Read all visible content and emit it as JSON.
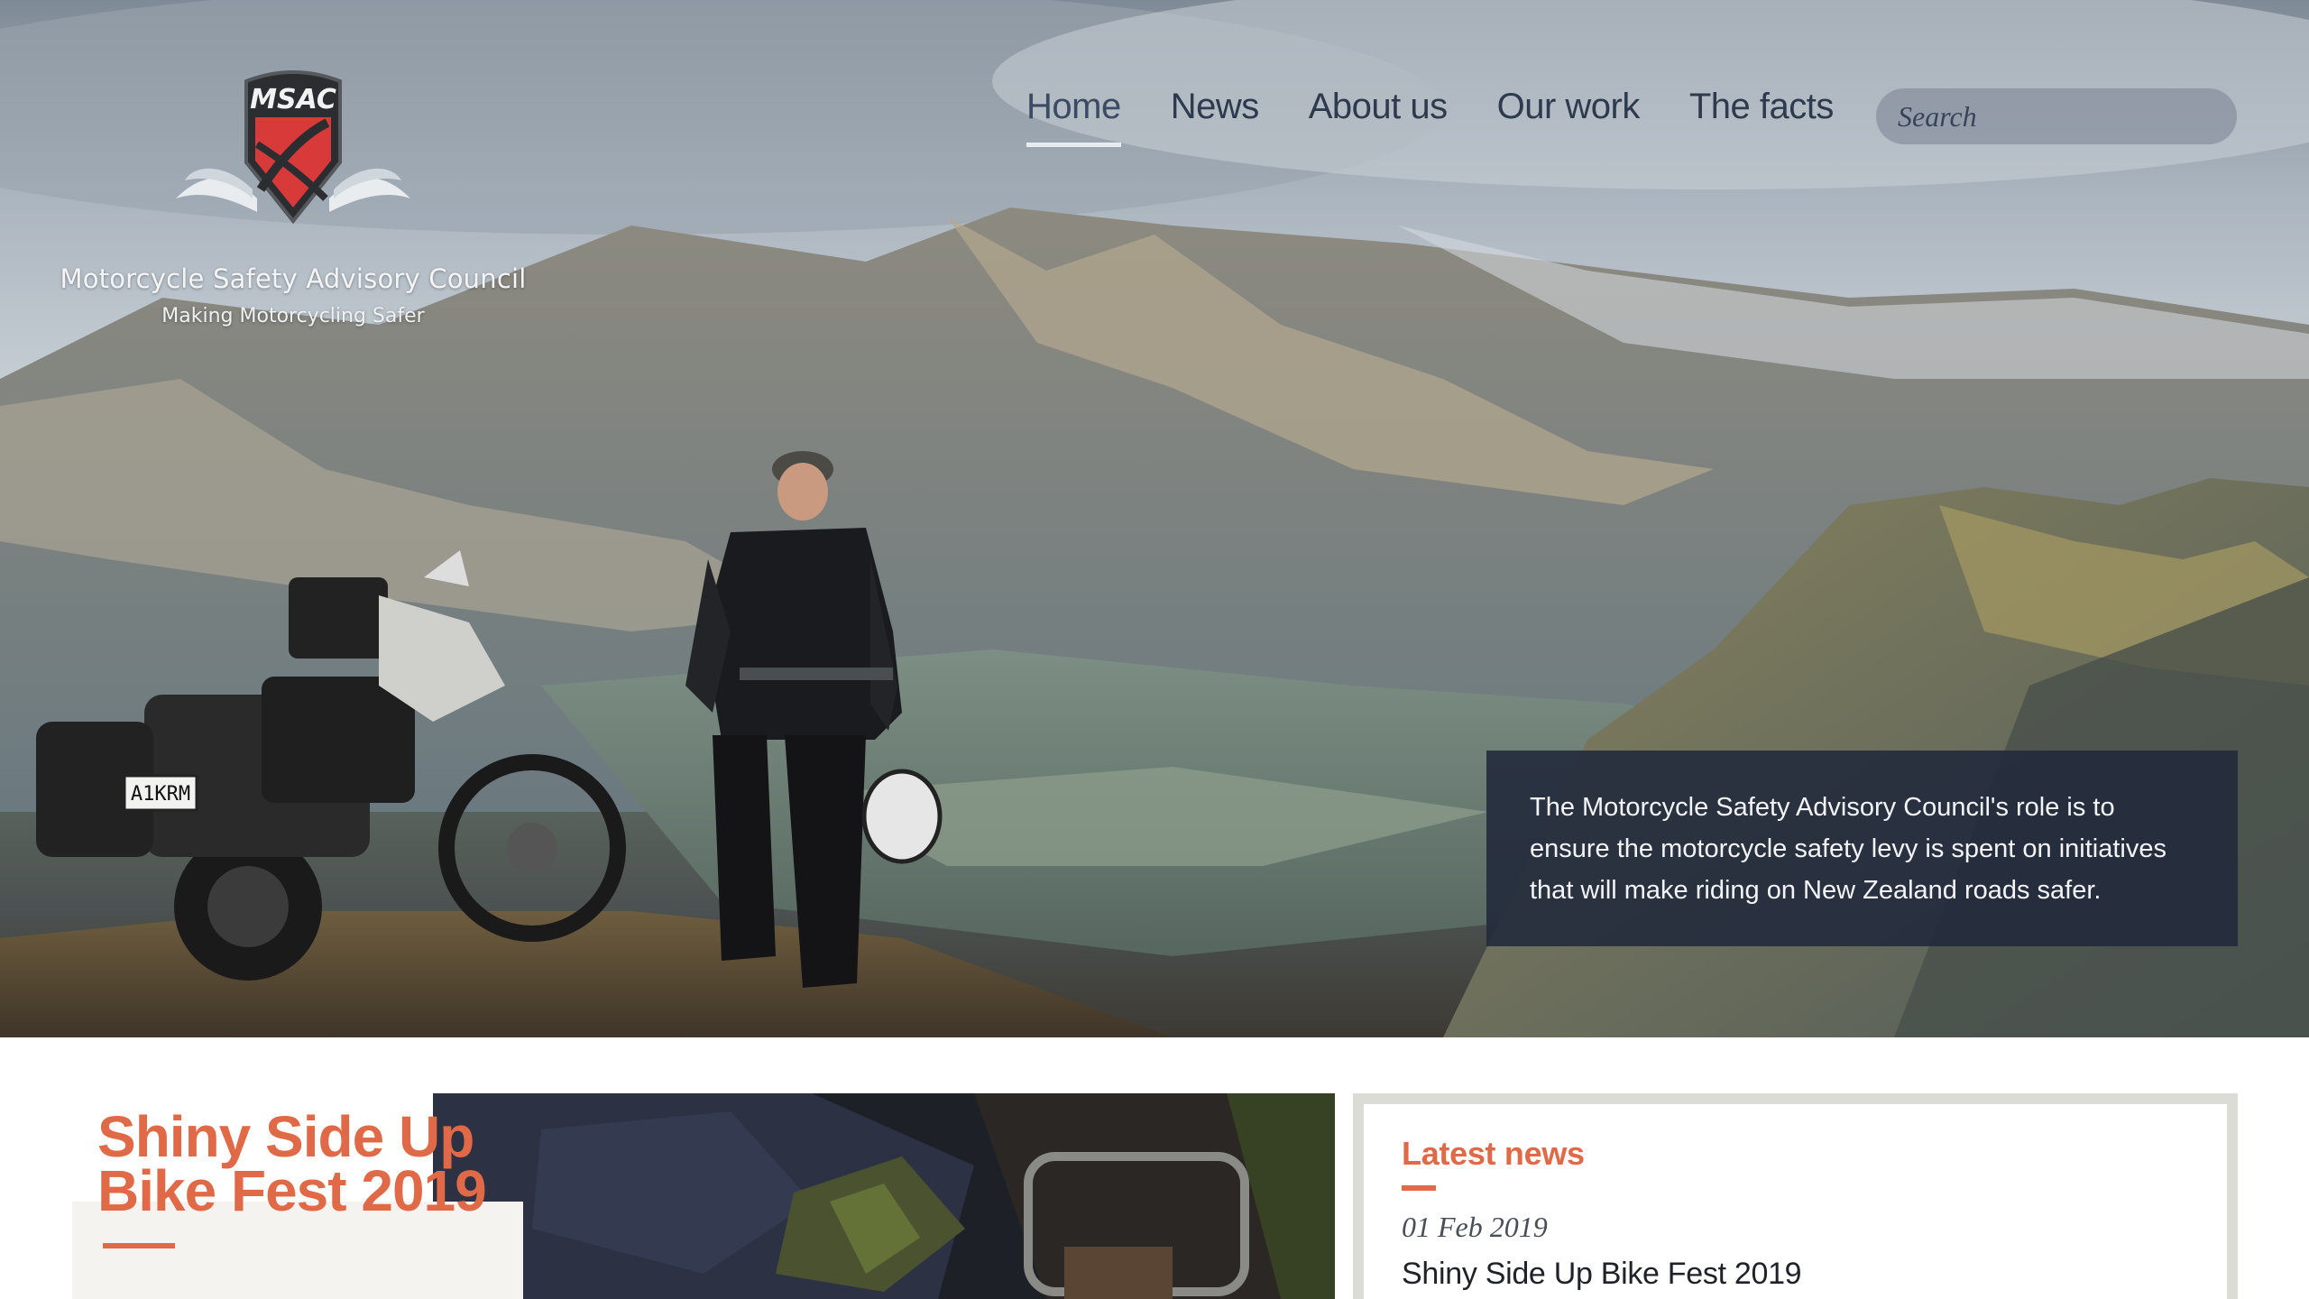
{
  "logo": {
    "badge_text": "MSAC",
    "org_name": "Motorcycle Safety Advisory Council",
    "tagline": "Making Motorcycling Safer"
  },
  "nav": {
    "items": [
      {
        "label": "Home",
        "active": true
      },
      {
        "label": "News",
        "active": false
      },
      {
        "label": "About us",
        "active": false
      },
      {
        "label": "Our work",
        "active": false
      },
      {
        "label": "The facts",
        "active": false
      }
    ]
  },
  "search": {
    "placeholder": "Search",
    "icon": "search-icon"
  },
  "hero": {
    "intro_text": "The Motorcycle Safety Advisory Council's role is to ensure the motorcycle safety levy is spent on initiatives that will make riding on New Zealand roads safer.",
    "plate_text": "A1KRM"
  },
  "feature": {
    "title": "Shiny Side Up Bike Fest 2019"
  },
  "latest_news": {
    "heading": "Latest news",
    "items": [
      {
        "date": "01 Feb 2019",
        "title": "Shiny Side Up Bike Fest 2019"
      }
    ]
  },
  "colors": {
    "accent": "#e06a47",
    "nav_text": "#2e3a4d",
    "intro_bg": "#222a3c",
    "panel_border": "#dcdcd7"
  }
}
